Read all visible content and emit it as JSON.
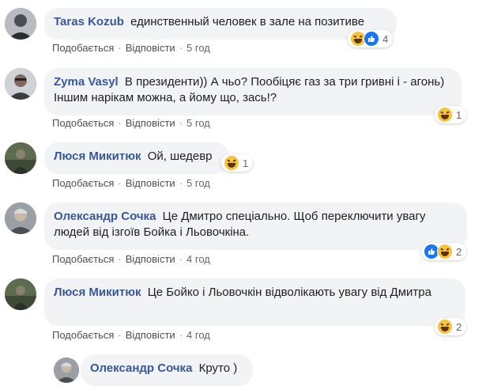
{
  "actions": {
    "like": "Подобається",
    "reply": "Відповісти",
    "separator": "·"
  },
  "comments": [
    {
      "author": "Taras Kozub",
      "text": "единственный человек в зале на позитиве",
      "time": "5 год",
      "reactions": [
        "haha-icon",
        "like-icon"
      ],
      "reaction_count": "4"
    },
    {
      "author": "Zyma Vasyl",
      "text": "В президенти)) А чьо? Пообіцяє газ за три гривні і - агонь) Іншим нарікам можна, а йому що, зась!?",
      "time": "5 год",
      "reactions": [
        "haha-icon"
      ],
      "reaction_count": "1"
    },
    {
      "author": "Люся Микитюк",
      "text": "Ой, шедевр",
      "time": "5 год",
      "reactions": [
        "haha-icon"
      ],
      "reaction_count": "1"
    },
    {
      "author": "Олександр Сочка",
      "text": "Це Дмитро спеціально. Щоб переключити увагу людей від ізгоїв Бойка і Льовочкіна.",
      "time": "4 год",
      "reactions": [
        "like-icon",
        "haha-icon"
      ],
      "reaction_count": "2"
    },
    {
      "author": "Люся Микитюк",
      "text": "Це Бойко і Льовочкін відволікають увагу від Дмитра",
      "time": "4 год",
      "reactions": [
        "haha-icon"
      ],
      "reaction_count": "2"
    }
  ],
  "reply": {
    "author": "Олександр Сочка",
    "text": "Круто )"
  },
  "colors": {
    "author": "#385898",
    "bubble": "#f2f3f5",
    "meta": "#606770",
    "like_blue": "#1877f2",
    "haha_yellow": "#f7c33b"
  }
}
